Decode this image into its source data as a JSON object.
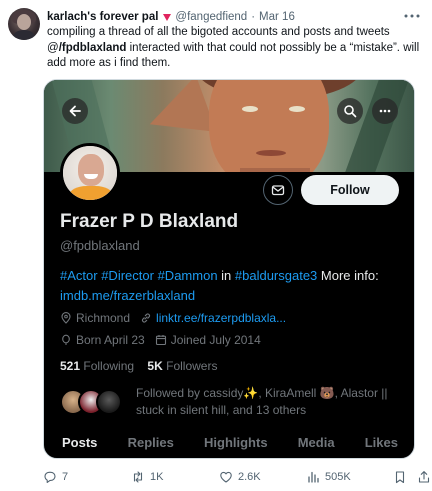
{
  "tweet": {
    "author_name": "karlach's forever pal",
    "author_handle": "@fangedfiend",
    "separator": "·",
    "date": "Mar 16",
    "text_before": "compiling a thread of all the bigoted accounts and posts and tweets @",
    "text_mention": "/fpdblaxland",
    "text_after": " interacted with that could not possibly be a “mistake”. will add more as i find them."
  },
  "profile": {
    "name": "Frazer P D Blaxland",
    "handle": "@fpdblaxland",
    "follow_label": "Follow",
    "bio_tag1": "#Actor",
    "bio_tag2": "#Director",
    "bio_tag3": "#Dammon",
    "bio_in": " in ",
    "bio_tag4": "#baldursgate3",
    "bio_more": " More info: ",
    "bio_link": "imdb.me/frazerblaxland",
    "location": "Richmond",
    "website": "linktr.ee/frazerpdblaxla...",
    "born": "Born April 23",
    "joined": "Joined July 2014",
    "following_count": "521",
    "following_label": "Following",
    "followers_count": "5K",
    "followers_label": "Followers",
    "followed_by": "Followed by cassidy✨, KiraAmell 🐻, Alastor || stuck in silent hill, and 13 others",
    "tabs": [
      "Posts",
      "Replies",
      "Highlights",
      "Media",
      "Likes"
    ]
  },
  "actions": {
    "replies": "7",
    "reposts": "1K",
    "likes": "2.6K",
    "views": "505K"
  },
  "icons": [
    "more-icon",
    "back-arrow-icon",
    "search-icon",
    "more-horizontal-icon",
    "message-icon",
    "location-icon",
    "link-icon",
    "balloon-icon",
    "calendar-icon",
    "reply-icon",
    "repost-icon",
    "like-icon",
    "views-icon",
    "bookmark-icon",
    "share-icon"
  ],
  "colors": {
    "link_blue": "#1d9bf0",
    "card_bg": "#000000",
    "muted": "#71767b"
  }
}
